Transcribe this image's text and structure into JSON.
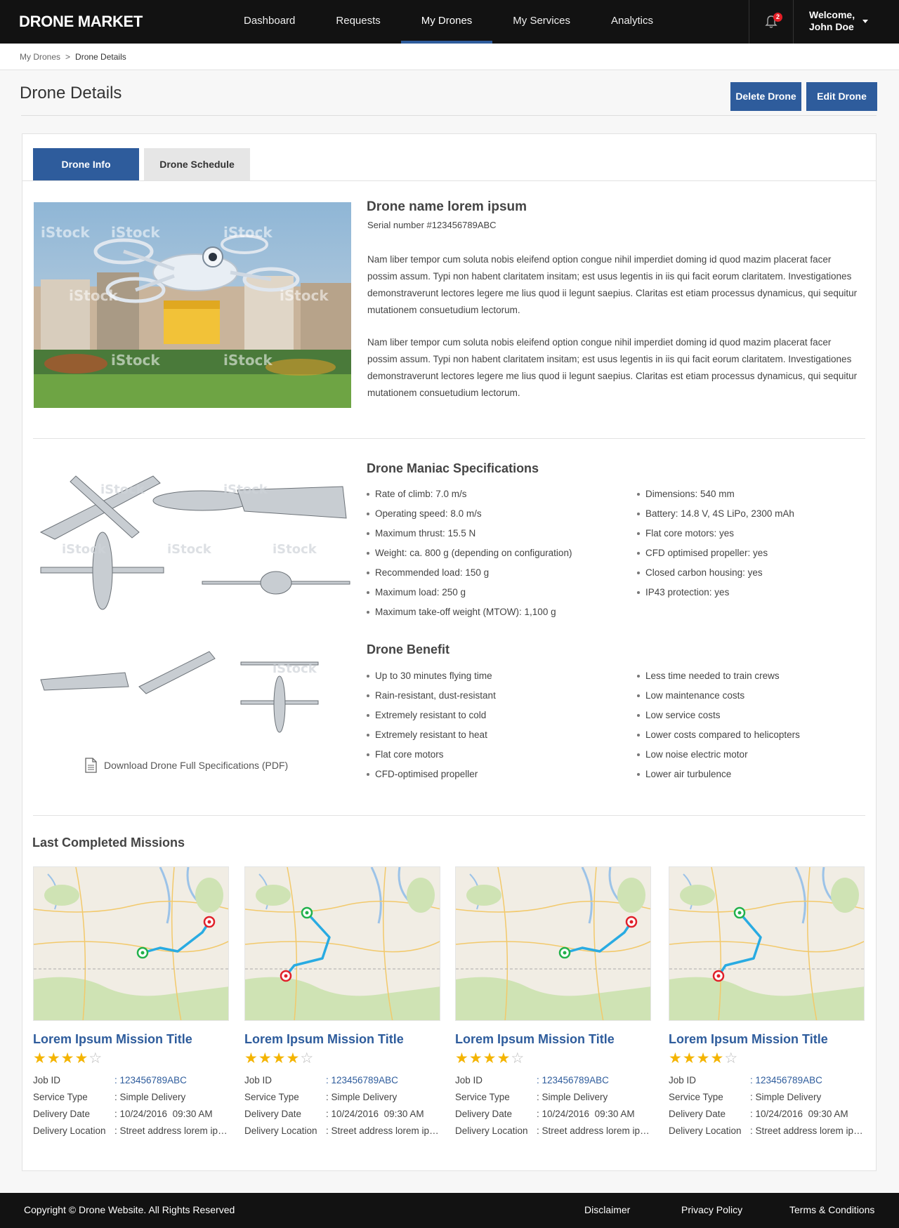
{
  "header": {
    "logo": "DRONE MARKET",
    "nav": [
      "Dashboard",
      "Requests",
      "My Drones",
      "My Services",
      "Analytics"
    ],
    "active_nav": "My Drones",
    "notification_count": "2",
    "welcome": "Welcome,",
    "user_name": "John Doe"
  },
  "breadcrumb": {
    "items": [
      "My Drones",
      "Drone Details"
    ],
    "separator": ">"
  },
  "page": {
    "title": "Drone Details",
    "delete_label": "Delete Drone",
    "edit_label": "Edit Drone"
  },
  "tabs": [
    "Drone Info",
    "Drone Schedule"
  ],
  "drone": {
    "name": "Drone name lorem ipsum",
    "serial": "Serial number #123456789ABC",
    "paragraphs": [
      "Nam liber tempor cum soluta nobis eleifend option congue nihil imperdiet doming id quod mazim placerat facer possim assum. Typi non habent claritatem insitam; est usus legentis in iis qui facit eorum claritatem. Investigationes demonstraverunt lectores legere me lius quod ii legunt saepius. Claritas est etiam processus dynamicus, qui sequitur mutationem consuetudium lectorum.",
      "Nam liber tempor cum soluta nobis eleifend option congue nihil imperdiet doming id quod mazim placerat facer possim assum. Typi non habent claritatem insitam; est usus legentis in iis qui facit eorum claritatem. Investigationes demonstraverunt lectores legere me lius quod ii legunt saepius. Claritas est etiam processus dynamicus, qui sequitur mutationem consuetudium lectorum."
    ]
  },
  "specs": {
    "title": "Drone Maniac Specifications",
    "left": [
      "Rate of climb: 7.0 m/s",
      "Operating speed: 8.0 m/s",
      "Maximum thrust: 15.5 N",
      "Weight: ca. 800 g (depending on configuration)",
      "Recommended load: 150 g",
      "Maximum load: 250 g",
      "Maximum take-off weight (MTOW): 1,100 g"
    ],
    "right": [
      "Dimensions: 540 mm",
      "Battery: 14.8 V, 4S LiPo, 2300 mAh",
      "Flat core motors: yes",
      "CFD optimised propeller: yes",
      "Closed carbon housing: yes",
      "IP43 protection: yes"
    ]
  },
  "benefits": {
    "title": "Drone Benefit",
    "left": [
      "Up to 30 minutes flying time",
      "Rain-resistant, dust-resistant",
      "Extremely resistant to cold",
      "Extremely resistant to heat",
      "Flat core motors",
      "CFD-optimised propeller"
    ],
    "right": [
      "Less time needed to train crews",
      "Low maintenance costs",
      "Low service costs",
      "Lower costs compared to helicopters",
      "Low noise electric motor",
      "Lower air turbulence"
    ]
  },
  "download_label": "Download Drone Full Specifications (PDF)",
  "watermark": "iStock",
  "missions_title": "Last Completed Missions",
  "mission_labels": {
    "job_id": "Job ID",
    "service_type": "Service Type",
    "delivery_date": "Delivery Date",
    "delivery_location": "Delivery Location"
  },
  "missions": [
    {
      "title": "Lorem Ipsum Mission Title",
      "rating": 4,
      "max_rating": 5,
      "job_id": ": 123456789ABC",
      "service_type": ": Simple Delivery",
      "delivery_date": ": 10/24/2016  09:30 AM",
      "delivery_location": ": Street address lorem ipsum"
    },
    {
      "title": "Lorem Ipsum Mission Title",
      "rating": 4,
      "max_rating": 5,
      "job_id": ": 123456789ABC",
      "service_type": ": Simple Delivery",
      "delivery_date": ": 10/24/2016  09:30 AM",
      "delivery_location": ": Street address lorem ipsum"
    },
    {
      "title": "Lorem Ipsum Mission Title",
      "rating": 4,
      "max_rating": 5,
      "job_id": ": 123456789ABC",
      "service_type": ": Simple Delivery",
      "delivery_date": ": 10/24/2016  09:30 AM",
      "delivery_location": ": Street address lorem ipsum"
    },
    {
      "title": "Lorem Ipsum Mission Title",
      "rating": 4,
      "max_rating": 5,
      "job_id": ": 123456789ABC",
      "service_type": ": Simple Delivery",
      "delivery_date": ": 10/24/2016  09:30 AM",
      "delivery_location": ": Street address lorem ipsum"
    }
  ],
  "footer": {
    "copyright": "Copyright © Drone Website. All Rights Reserved",
    "links": [
      "Disclaimer",
      "Privacy Policy",
      "Terms & Conditions"
    ]
  },
  "colors": {
    "accent": "#2e5c9c",
    "header_bg": "#121212",
    "star": "#f4b400",
    "route": "#29abe2",
    "start_pin": "#22b14c",
    "end_pin": "#e0202a"
  }
}
